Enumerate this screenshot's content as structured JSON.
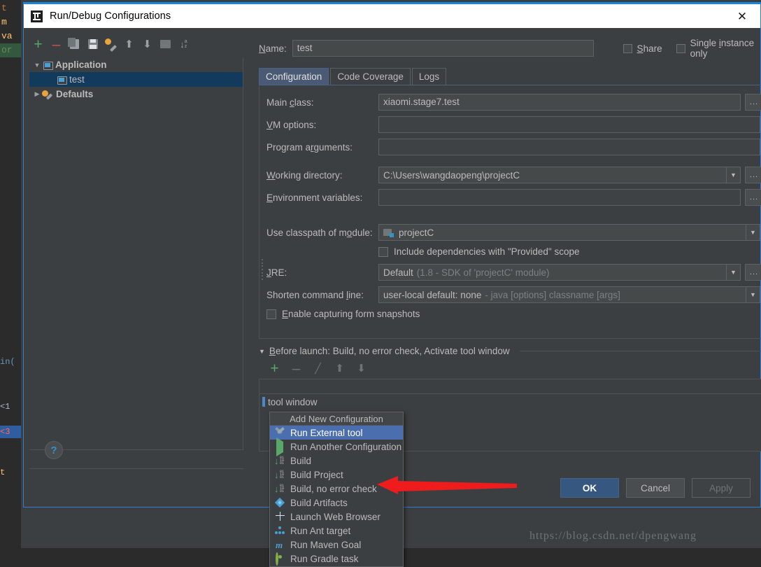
{
  "window": {
    "title": "Run/Debug Configurations",
    "logo_icon": "intellij-idea-logo",
    "close_icon": "close-icon"
  },
  "left_pane": {
    "toolbar": [
      {
        "name": "add-configuration-button",
        "icon": "plus-icon",
        "glyph": "+"
      },
      {
        "name": "remove-configuration-button",
        "icon": "minus-icon",
        "glyph": "–"
      },
      {
        "name": "copy-configuration-button",
        "icon": "copy-icon"
      },
      {
        "name": "save-configuration-button",
        "icon": "save-icon"
      },
      {
        "name": "edit-defaults-button",
        "icon": "wrench-icon"
      },
      {
        "name": "move-up-button",
        "icon": "arrow-up-icon",
        "glyph": "⬆"
      },
      {
        "name": "move-down-button",
        "icon": "arrow-down-icon",
        "glyph": "⬇"
      },
      {
        "name": "new-folder-button",
        "icon": "folder-icon"
      },
      {
        "name": "sort-configurations-button",
        "icon": "sort-az-icon",
        "glyph": "↓"
      }
    ],
    "tree": [
      {
        "label": "Application",
        "level": 0,
        "expanded": true,
        "icon": "application-icon",
        "selected": false
      },
      {
        "label": "test",
        "level": 1,
        "expanded": null,
        "icon": "application-icon",
        "selected": true
      },
      {
        "label": "Defaults",
        "level": 0,
        "expanded": false,
        "icon": "defaults-icon",
        "selected": false
      }
    ],
    "help_label": "?"
  },
  "form": {
    "name_label": "Name:",
    "name_label_mnemonic": "N",
    "name_value": "test",
    "share_label": "Share",
    "share_checked": false,
    "single_instance_label": "Single instance only",
    "single_instance_checked": false,
    "tabs": [
      {
        "label": "Configuration",
        "active": true
      },
      {
        "label": "Code Coverage",
        "active": false
      },
      {
        "label": "Logs",
        "active": false
      }
    ],
    "fields": {
      "main_class_label": "Main class:",
      "main_class_value": "xiaomi.stage7.test",
      "vm_options_label": "VM options:",
      "vm_options_value": "",
      "program_arguments_label": "Program arguments:",
      "program_arguments_value": "",
      "working_directory_label": "Working directory:",
      "working_directory_value": "C:\\Users\\wangdaopeng\\projectC",
      "environment_variables_label": "Environment variables:",
      "environment_variables_value": "",
      "use_classpath_label": "Use classpath of module:",
      "use_classpath_value": "projectC",
      "include_dependencies_label": "Include dependencies with \"Provided\" scope",
      "include_dependencies_checked": false,
      "jre_label": "JRE:",
      "jre_value": "Default",
      "jre_value_hint": "(1.8 - SDK of 'projectC' module)",
      "shorten_command_line_label": "Shorten command line:",
      "shorten_command_line_value": "user-local default: none",
      "shorten_command_line_hint": "- java [options] classname [args]",
      "enable_snapshots_label": "Enable capturing form snapshots",
      "enable_snapshots_checked": false,
      "browse_button_label": "...",
      "dropdown_icon": "chevron-down-icon",
      "expand_icon": "expand-editor-icon"
    }
  },
  "before_launch": {
    "title": "Before launch: Build, no error check, Activate tool window",
    "expanded": true,
    "toolbar": [
      {
        "name": "add-task-button",
        "icon": "plus-icon",
        "glyph": "+"
      },
      {
        "name": "remove-task-button",
        "icon": "minus-icon",
        "glyph": "–"
      },
      {
        "name": "edit-task-button",
        "icon": "pencil-icon",
        "glyph": "╱"
      },
      {
        "name": "move-task-up-button",
        "icon": "arrow-up-icon",
        "glyph": "⬆"
      },
      {
        "name": "move-task-down-button",
        "icon": "arrow-down-icon",
        "glyph": "⬇"
      }
    ],
    "items": [
      {
        "label": "tool window"
      }
    ]
  },
  "popup_menu": {
    "title": "Add New Configuration",
    "items": [
      {
        "label": "Run External tool",
        "icon": "external-tool-icon",
        "selected": true
      },
      {
        "label": "Run Another Configuration",
        "icon": "run-play-icon",
        "selected": false
      },
      {
        "label": "Build",
        "icon": "build-icon",
        "selected": false
      },
      {
        "label": "Build Project",
        "icon": "build-icon",
        "selected": false
      },
      {
        "label": "Build, no error check",
        "icon": "build-icon",
        "selected": false
      },
      {
        "label": "Build Artifacts",
        "icon": "artifacts-icon",
        "selected": false
      },
      {
        "label": "Launch Web Browser",
        "icon": "globe-icon",
        "selected": false
      },
      {
        "label": "Run Ant target",
        "icon": "ant-icon",
        "selected": false
      },
      {
        "label": "Run Maven Goal",
        "icon": "maven-icon",
        "selected": false
      },
      {
        "label": "Run Gradle task",
        "icon": "gradle-icon",
        "selected": false
      }
    ]
  },
  "footer": {
    "ok_label": "OK",
    "cancel_label": "Cancel",
    "apply_label": "Apply",
    "apply_disabled": true
  },
  "annotation": {
    "arrow_color": "#ee1c1c",
    "points_to": "Build, no error check"
  },
  "watermark": "https://blog.csdn.net/dpengwang",
  "background_code": {
    "lines": [
      "t",
      "m",
      "va",
      "or"
    ],
    "lower_lines": [
      "in(",
      "<1",
      "<3",
      "t"
    ]
  },
  "colors": {
    "dialog_bg": "#3c3f41",
    "accent_blue": "#2d7cd6",
    "selection_blue": "#4b6eaf",
    "tree_selection": "#113a5c",
    "ok_button": "#365880",
    "text": "#bbbbbb"
  }
}
